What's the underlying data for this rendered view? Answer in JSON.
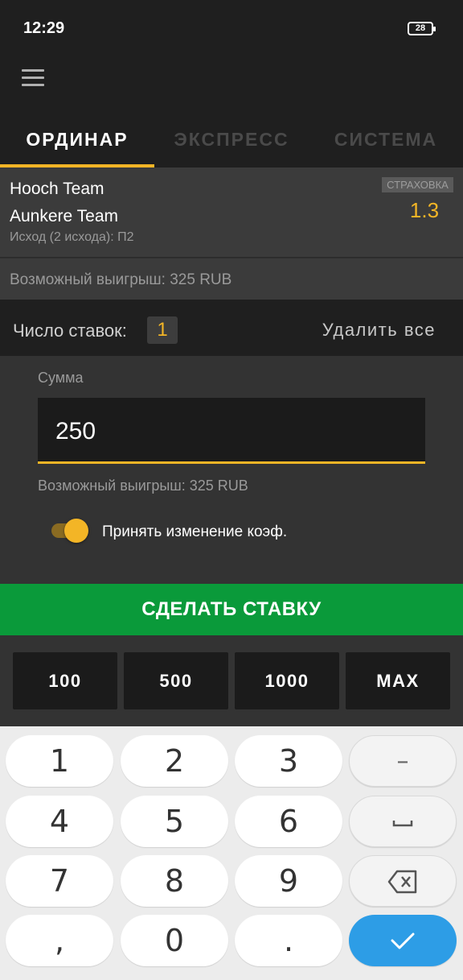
{
  "status_bar": {
    "time": "12:29",
    "battery": "28"
  },
  "tabs": [
    {
      "label": "ОРДИНАР",
      "active": true
    },
    {
      "label": "ЭКСПРЕСС",
      "active": false
    },
    {
      "label": "СИСТЕМА",
      "active": false
    }
  ],
  "bet": {
    "team1": "Hooch Team",
    "team2": "Aunkere Team",
    "outcome": "Исход (2 исхода): П2",
    "insurance_label": "СТРАХОВКА",
    "coef": "1.3",
    "possible_win": "Возможный выигрыш: 325 RUB"
  },
  "bets_count": {
    "label": "Число ставок:",
    "value": "1",
    "delete_all": "Удалить все"
  },
  "form": {
    "sum_label": "Сумма",
    "sum_value": "250",
    "possible_win": "Возможный выигрыш: 325 RUB",
    "accept_changes_label": "Принять изменение коэф.",
    "accept_changes_on": true
  },
  "submit_label": "СДЕЛАТЬ СТАВКУ",
  "quick_amounts": [
    "100",
    "500",
    "1000",
    "MAX"
  ],
  "keyboard": {
    "rows": [
      [
        "1",
        "2",
        "3",
        "–"
      ],
      [
        "4",
        "5",
        "6",
        "space-icon"
      ],
      [
        "7",
        "8",
        "9",
        "backspace-icon"
      ],
      [
        ",",
        "0",
        ".",
        "check-icon"
      ]
    ]
  },
  "colors": {
    "accent": "#f3b526",
    "submit": "#0a9a3a",
    "keyboard_ok": "#2d9de6"
  }
}
